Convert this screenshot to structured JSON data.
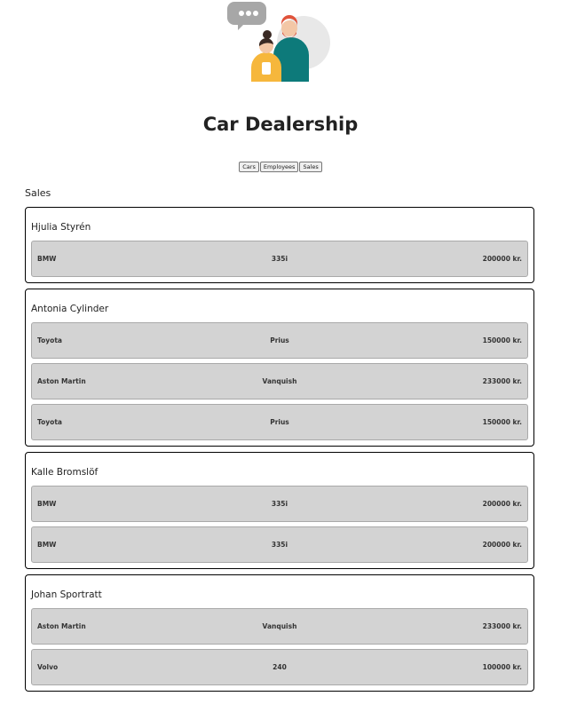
{
  "page": {
    "title": "Car Dealership"
  },
  "nav": {
    "cars": "Cars",
    "employees": "Employees",
    "sales": "Sales"
  },
  "section": {
    "heading": "Sales"
  },
  "colors": {
    "bubble": "#a7a7a7",
    "backdrop": "#e8e8e8",
    "man_shirt": "#0d7a7a",
    "man_hair": "#e0533b",
    "woman_shirt": "#f6b73c",
    "woman_hair": "#3a2a24",
    "skin": "#f3c7a6",
    "row_bg": "#d3d3d3"
  },
  "sales": [
    {
      "employee": "Hjulia Styrén",
      "cars": [
        {
          "make": "BMW",
          "model": "335i",
          "price": "200000 kr."
        }
      ]
    },
    {
      "employee": "Antonia Cylinder",
      "cars": [
        {
          "make": "Toyota",
          "model": "Prius",
          "price": "150000 kr."
        },
        {
          "make": "Aston Martin",
          "model": "Vanquish",
          "price": "233000 kr."
        },
        {
          "make": "Toyota",
          "model": "Prius",
          "price": "150000 kr."
        }
      ]
    },
    {
      "employee": "Kalle Bromslöf",
      "cars": [
        {
          "make": "BMW",
          "model": "335i",
          "price": "200000 kr."
        },
        {
          "make": "BMW",
          "model": "335i",
          "price": "200000 kr."
        }
      ]
    },
    {
      "employee": "Johan Sportratt",
      "cars": [
        {
          "make": "Aston Martin",
          "model": "Vanquish",
          "price": "233000 kr."
        },
        {
          "make": "Volvo",
          "model": "240",
          "price": "100000 kr."
        }
      ]
    }
  ]
}
